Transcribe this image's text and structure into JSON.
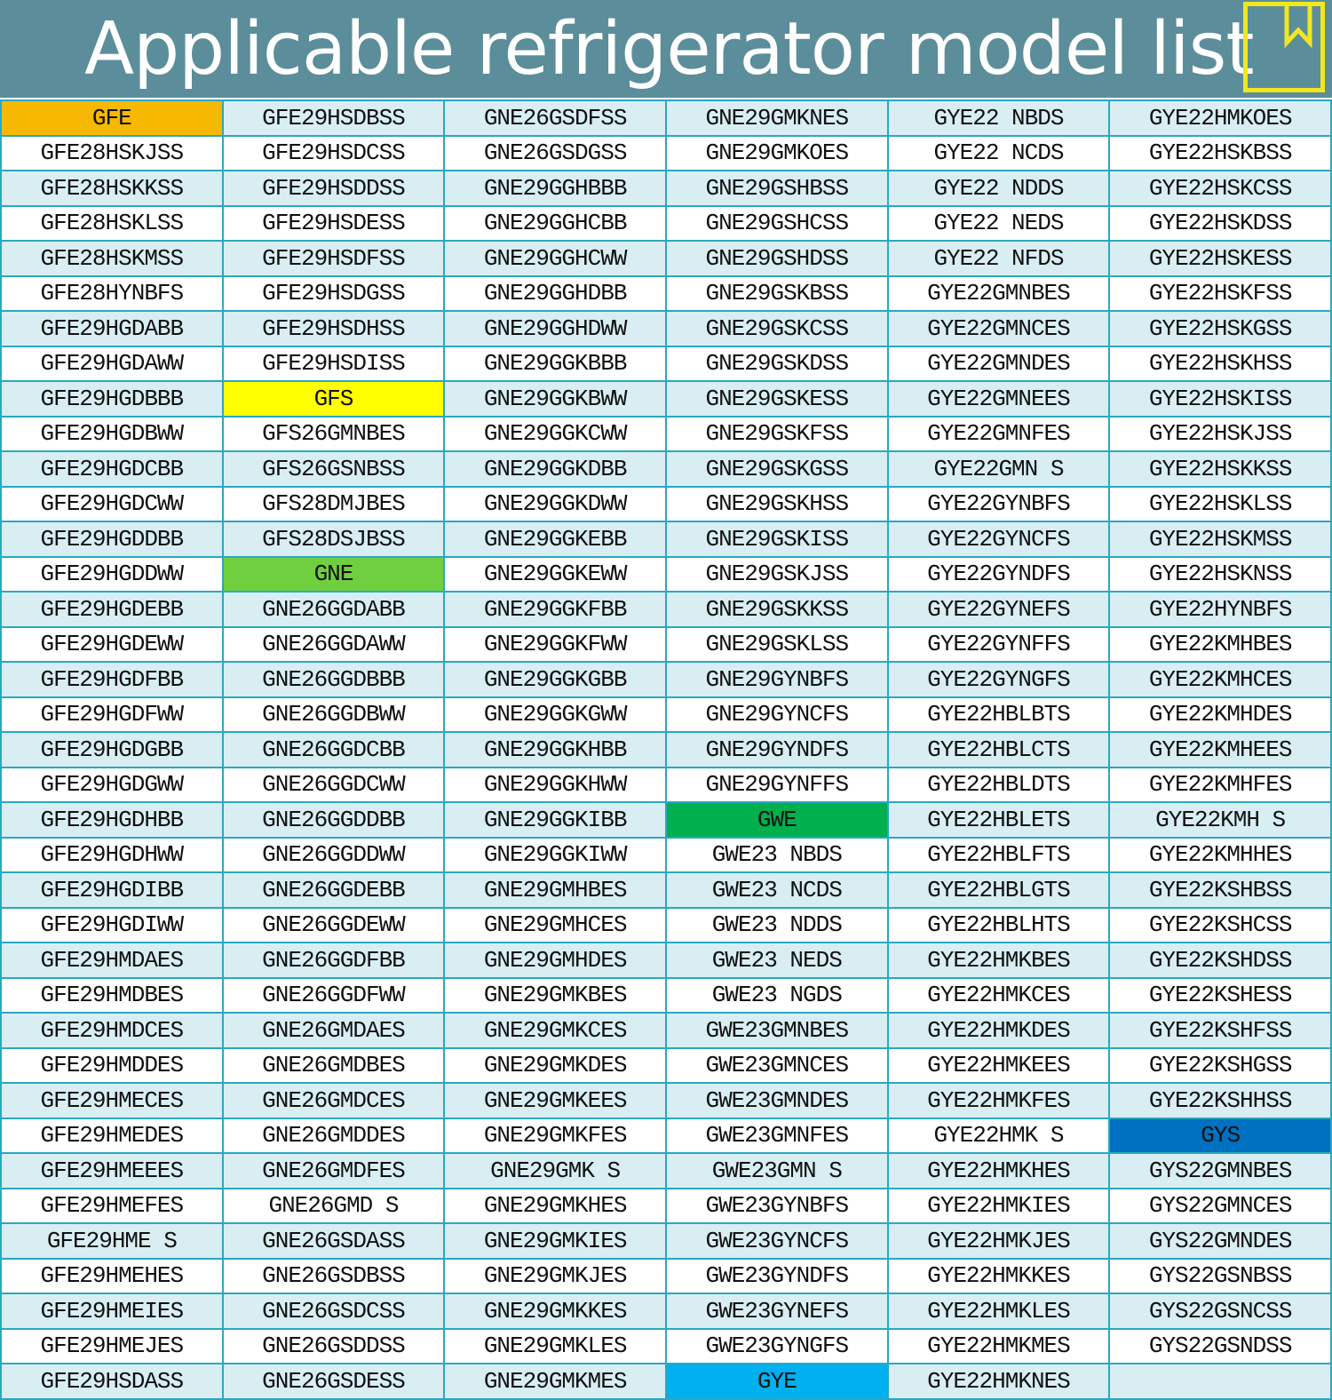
{
  "title": "Applicable refrigerator model list",
  "icons": {
    "corner": "bookmark-icon"
  },
  "series_colors": {
    "GFE": "#f6b800",
    "GFS": "#ffff00",
    "GNE": "#6fcf3f",
    "GWE": "#00b04f",
    "GYE": "#00b0f0",
    "GYS": "#0070c0"
  },
  "columns": [
    [
      "GFE",
      "GFE28HSKJSS",
      "GFE28HSKKSS",
      "GFE28HSKLSS",
      "GFE28HSKMSS",
      "GFE28HYNBFS",
      "GFE29HGDABB",
      "GFE29HGDAWW",
      "GFE29HGDBBB",
      "GFE29HGDBWW",
      "GFE29HGDCBB",
      "GFE29HGDCWW",
      "GFE29HGDDBB",
      "GFE29HGDDWW",
      "GFE29HGDEBB",
      "GFE29HGDEWW",
      "GFE29HGDFBB",
      "GFE29HGDFWW",
      "GFE29HGDGBB",
      "GFE29HGDGWW",
      "GFE29HGDHBB",
      "GFE29HGDHWW",
      "GFE29HGDIBB",
      "GFE29HGDIWW",
      "GFE29HMDAES",
      "GFE29HMDBES",
      "GFE29HMDCES",
      "GFE29HMDDES",
      "GFE29HMECES",
      "GFE29HMEDES",
      "GFE29HMEEES",
      "GFE29HMEFES",
      "GFE29HME S",
      "GFE29HMEHES",
      "GFE29HMEIES",
      "GFE29HMEJES",
      "GFE29HSDASS"
    ],
    [
      "GFE29HSDBSS",
      "GFE29HSDCSS",
      "GFE29HSDDSS",
      "GFE29HSDESS",
      "GFE29HSDFSS",
      "GFE29HSDGSS",
      "GFE29HSDHSS",
      "GFE29HSDISS",
      "GFS",
      "GFS26GMNBES",
      "GFS26GSNBSS",
      "GFS28DMJBES",
      "GFS28DSJBSS",
      "GNE",
      "GNE26GGDABB",
      "GNE26GGDAWW",
      "GNE26GGDBBB",
      "GNE26GGDBWW",
      "GNE26GGDCBB",
      "GNE26GGDCWW",
      "GNE26GGDDBB",
      "GNE26GGDDWW",
      "GNE26GGDEBB",
      "GNE26GGDEWW",
      "GNE26GGDFBB",
      "GNE26GGDFWW",
      "GNE26GMDAES",
      "GNE26GMDBES",
      "GNE26GMDCES",
      "GNE26GMDDES",
      "GNE26GMDFES",
      "GNE26GMD S",
      "GNE26GSDASS",
      "GNE26GSDBSS",
      "GNE26GSDCSS",
      "GNE26GSDDSS",
      "GNE26GSDESS"
    ],
    [
      "GNE26GSDFSS",
      "GNE26GSDGSS",
      "GNE29GGHBBB",
      "GNE29GGHCBB",
      "GNE29GGHCWW",
      "GNE29GGHDBB",
      "GNE29GGHDWW",
      "GNE29GGKBBB",
      "GNE29GGKBWW",
      "GNE29GGKCWW",
      "GNE29GGKDBB",
      "GNE29GGKDWW",
      "GNE29GGKEBB",
      "GNE29GGKEWW",
      "GNE29GGKFBB",
      "GNE29GGKFWW",
      "GNE29GGKGBB",
      "GNE29GGKGWW",
      "GNE29GGKHBB",
      "GNE29GGKHWW",
      "GNE29GGKIBB",
      "GNE29GGKIWW",
      "GNE29GMHBES",
      "GNE29GMHCES",
      "GNE29GMHDES",
      "GNE29GMKBES",
      "GNE29GMKCES",
      "GNE29GMKDES",
      "GNE29GMKEES",
      "GNE29GMKFES",
      "GNE29GMK S",
      "GNE29GMKHES",
      "GNE29GMKIES",
      "GNE29GMKJES",
      "GNE29GMKKES",
      "GNE29GMKLES",
      "GNE29GMKMES"
    ],
    [
      "GNE29GMKNES",
      "GNE29GMKOES",
      "GNE29GSHBSS",
      "GNE29GSHCSS",
      "GNE29GSHDSS",
      "GNE29GSKBSS",
      "GNE29GSKCSS",
      "GNE29GSKDSS",
      "GNE29GSKESS",
      "GNE29GSKFSS",
      "GNE29GSKGSS",
      "GNE29GSKHSS",
      "GNE29GSKISS",
      "GNE29GSKJSS",
      "GNE29GSKKSS",
      "GNE29GSKLSS",
      "GNE29GYNBFS",
      "GNE29GYNCFS",
      "GNE29GYNDFS",
      "GNE29GYNFFS",
      "GWE",
      "GWE23 NBDS",
      "GWE23 NCDS",
      "GWE23 NDDS",
      "GWE23 NEDS",
      "GWE23 NGDS",
      "GWE23GMNBES",
      "GWE23GMNCES",
      "GWE23GMNDES",
      "GWE23GMNFES",
      "GWE23GMN S",
      "GWE23GYNBFS",
      "GWE23GYNCFS",
      "GWE23GYNDFS",
      "GWE23GYNEFS",
      "GWE23GYNGFS",
      "GYE"
    ],
    [
      "GYE22 NBDS",
      "GYE22 NCDS",
      "GYE22 NDDS",
      "GYE22 NEDS",
      "GYE22 NFDS",
      "GYE22GMNBES",
      "GYE22GMNCES",
      "GYE22GMNDES",
      "GYE22GMNEES",
      "GYE22GMNFES",
      "GYE22GMN S",
      "GYE22GYNBFS",
      "GYE22GYNCFS",
      "GYE22GYNDFS",
      "GYE22GYNEFS",
      "GYE22GYNFFS",
      "GYE22GYNGFS",
      "GYE22HBLBTS",
      "GYE22HBLCTS",
      "GYE22HBLDTS",
      "GYE22HBLETS",
      "GYE22HBLFTS",
      "GYE22HBLGTS",
      "GYE22HBLHTS",
      "GYE22HMKBES",
      "GYE22HMKCES",
      "GYE22HMKDES",
      "GYE22HMKEES",
      "GYE22HMKFES",
      "GYE22HMK S",
      "GYE22HMKHES",
      "GYE22HMKIES",
      "GYE22HMKJES",
      "GYE22HMKKES",
      "GYE22HMKLES",
      "GYE22HMKMES",
      "GYE22HMKNES"
    ],
    [
      "GYE22HMKOES",
      "GYE22HSKBSS",
      "GYE22HSKCSS",
      "GYE22HSKDSS",
      "GYE22HSKESS",
      "GYE22HSKFSS",
      "GYE22HSKGSS",
      "GYE22HSKHSS",
      "GYE22HSKISS",
      "GYE22HSKJSS",
      "GYE22HSKKSS",
      "GYE22HSKLSS",
      "GYE22HSKMSS",
      "GYE22HSKNSS",
      "GYE22HYNBFS",
      "GYE22KMHBES",
      "GYE22KMHCES",
      "GYE22KMHDES",
      "GYE22KMHEES",
      "GYE22KMHFES",
      "GYE22KMH S",
      "GYE22KMHHES",
      "GYE22KSHBSS",
      "GYE22KSHCSS",
      "GYE22KSHDSS",
      "GYE22KSHESS",
      "GYE22KSHFSS",
      "GYE22KSHGSS",
      "GYE22KSHHSS",
      "GYS",
      "GYS22GMNBES",
      "GYS22GMNCES",
      "GYS22GMNDES",
      "GYS22GSNBSS",
      "GYS22GSNCSS",
      "GYS22GSNDSS",
      ""
    ]
  ]
}
